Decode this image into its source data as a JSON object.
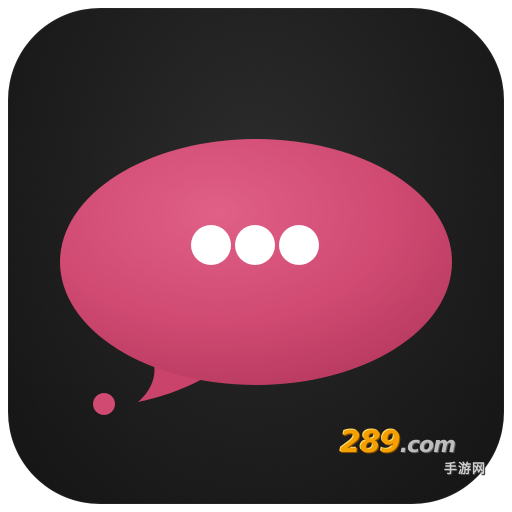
{
  "icon": {
    "name": "chat-app-icon",
    "background_color": "#1e1e1e",
    "bubble_color": "#d64a73",
    "dot_color": "#ffffff",
    "glyph": "speech-bubble-with-ellipsis"
  },
  "watermark": {
    "number": "289",
    "domain": ".com",
    "subtitle": "手游网",
    "number_color": "#f4a100"
  }
}
